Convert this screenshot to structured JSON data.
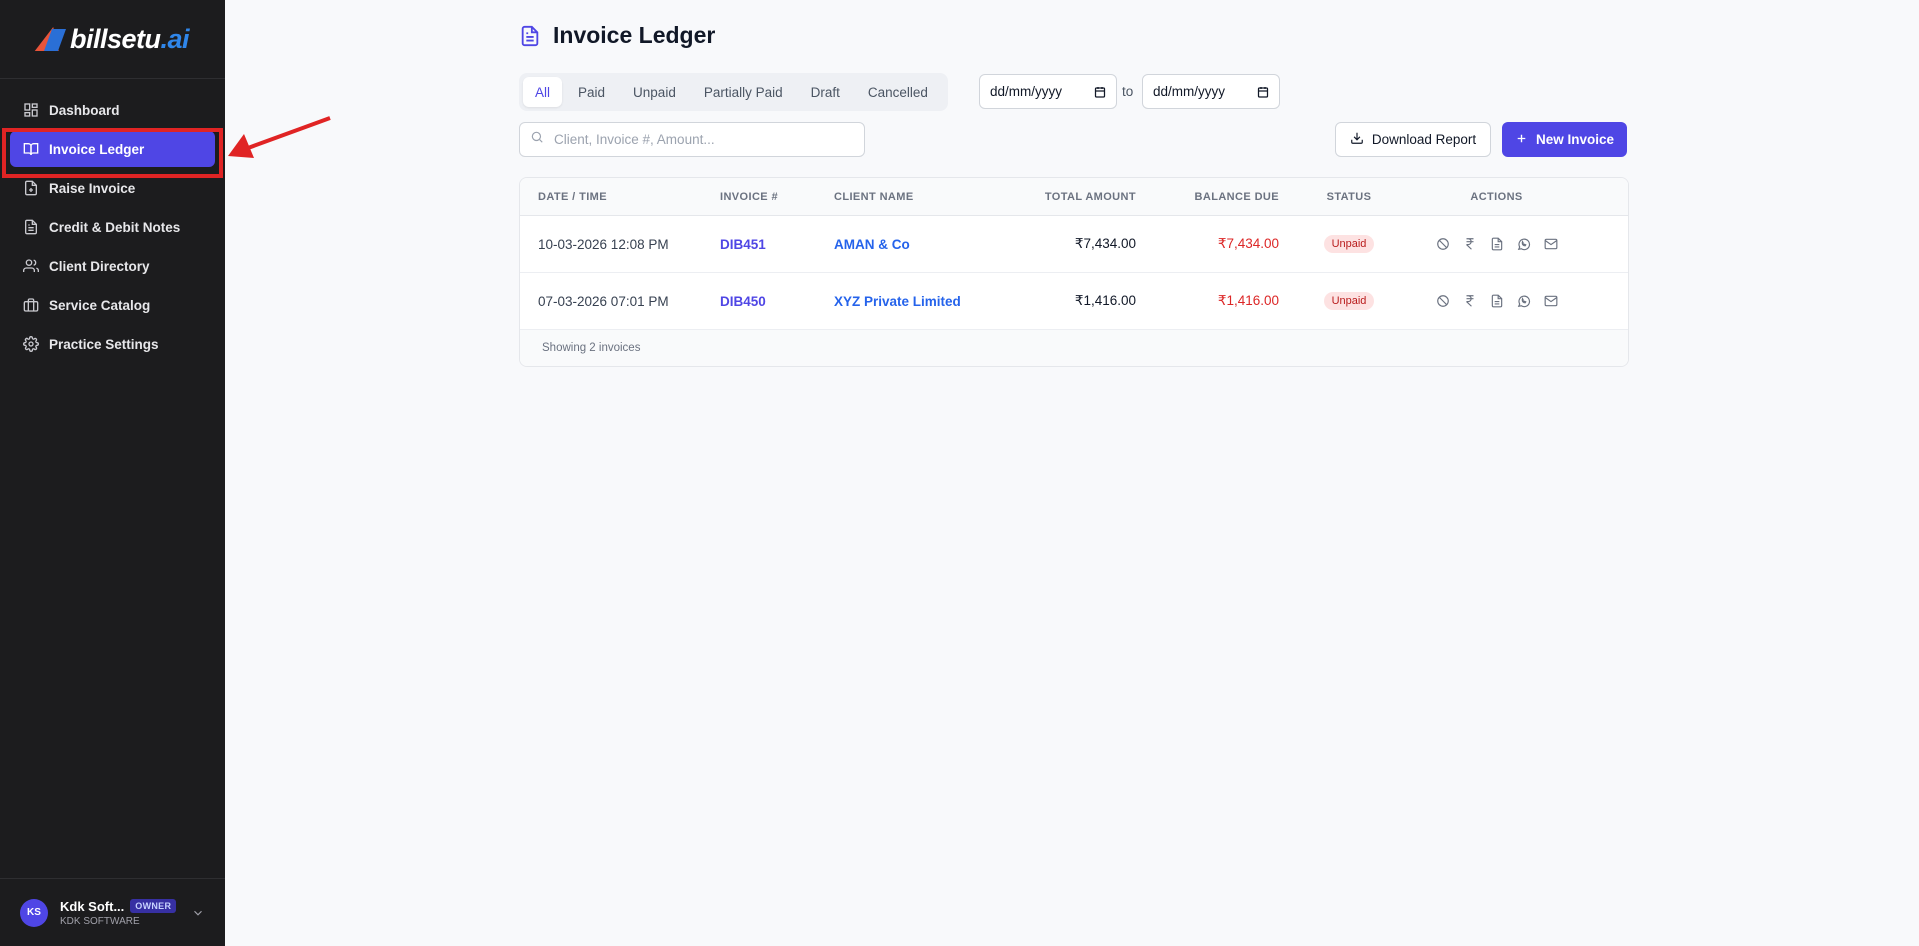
{
  "brand": {
    "name_main": "billsetu",
    "name_suffix": ".ai"
  },
  "sidebar": {
    "items": [
      {
        "label": "Dashboard",
        "icon": "grid-icon"
      },
      {
        "label": "Invoice Ledger",
        "icon": "book-open-icon",
        "active": true
      },
      {
        "label": "Raise Invoice",
        "icon": "file-plus-icon"
      },
      {
        "label": "Credit & Debit Notes",
        "icon": "file-text-icon"
      },
      {
        "label": "Client Directory",
        "icon": "users-icon"
      },
      {
        "label": "Service Catalog",
        "icon": "briefcase-icon"
      },
      {
        "label": "Practice Settings",
        "icon": "gear-icon"
      }
    ],
    "user": {
      "initials": "KS",
      "name": "Kdk Soft...",
      "role": "OWNER",
      "org": "KDK SOFTWARE"
    }
  },
  "header": {
    "title": "Invoice Ledger"
  },
  "filters": {
    "tabs": [
      "All",
      "Paid",
      "Unpaid",
      "Partially Paid",
      "Draft",
      "Cancelled"
    ],
    "active_tab": "All",
    "date_from": "dd/mm/yyyy",
    "date_to": "dd/mm/yyyy",
    "to_label": "to"
  },
  "search": {
    "placeholder": "Client, Invoice #, Amount..."
  },
  "toolbar": {
    "download_label": "Download Report",
    "new_label": "New Invoice"
  },
  "table": {
    "columns": [
      "DATE / TIME",
      "INVOICE #",
      "CLIENT NAME",
      "TOTAL AMOUNT",
      "BALANCE DUE",
      "STATUS",
      "ACTIONS"
    ],
    "rows": [
      {
        "date": "10-03-2026 12:08 PM",
        "invoice": "DIB451",
        "client": "AMAN & Co",
        "total": "₹7,434.00",
        "balance": "₹7,434.00",
        "status": "Unpaid"
      },
      {
        "date": "07-03-2026 07:01 PM",
        "invoice": "DIB450",
        "client": "XYZ Private Limited",
        "total": "₹1,416.00",
        "balance": "₹1,416.00",
        "status": "Unpaid"
      }
    ],
    "footer": "Showing 2 invoices"
  },
  "colors": {
    "accent": "#4f46e5",
    "sidebar_bg": "#1c1c1e",
    "danger": "#dc2626",
    "annotation": "#e02424"
  }
}
